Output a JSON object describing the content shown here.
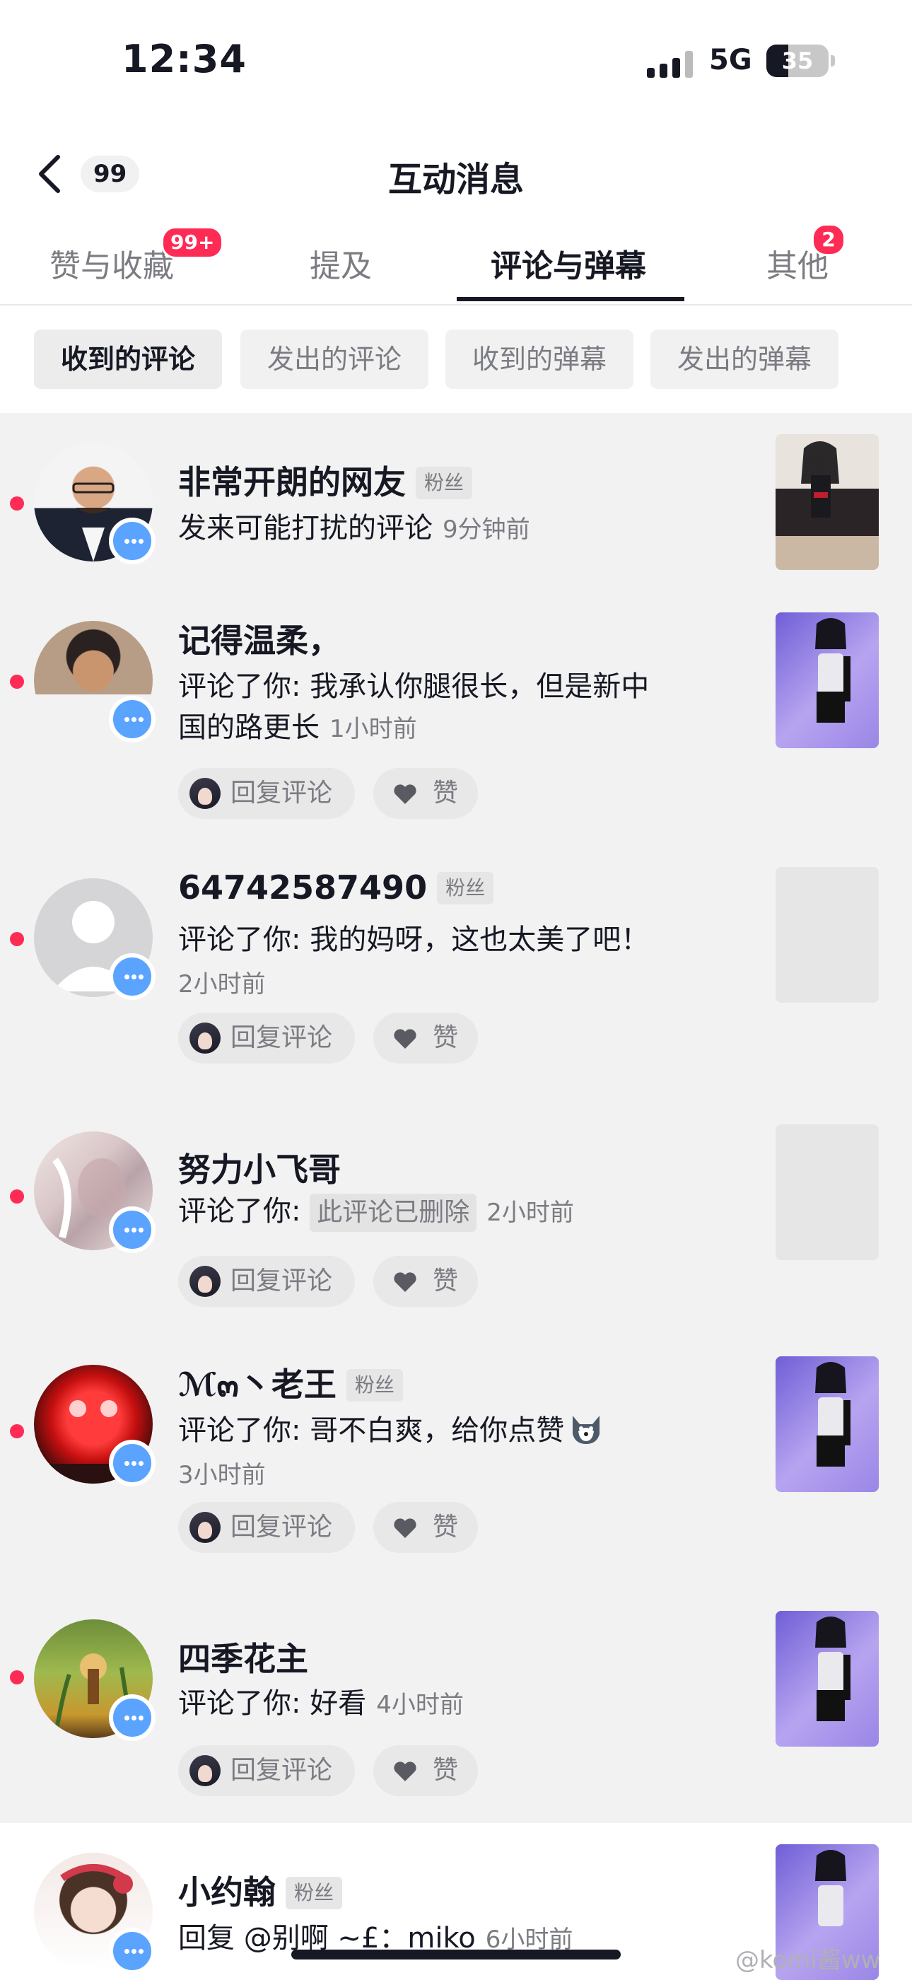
{
  "status_bar": {
    "time": "12:34",
    "network": "5G",
    "battery": 35
  },
  "header": {
    "back_count": "99",
    "title": "互动消息"
  },
  "tabs": [
    {
      "label": "赞与收藏",
      "badge": "99+"
    },
    {
      "label": "提及",
      "badge": ""
    },
    {
      "label": "评论与弹幕",
      "badge": "",
      "active": true
    },
    {
      "label": "其他",
      "badge": "2"
    }
  ],
  "filters": [
    "收到的评论",
    "发出的评论",
    "收到的弹幕",
    "发出的弹幕"
  ],
  "actions": {
    "reply": "回复评论",
    "like": "赞"
  },
  "items": [
    {
      "name": "非常开朗的网友",
      "tag": "粉丝",
      "text": "发来可能打扰的评论",
      "time": "9分钟前"
    },
    {
      "name": "记得温柔，",
      "tag": "",
      "text": "评论了你: 我承认你腿很长，但是新中国的路更长",
      "time": "1小时前"
    },
    {
      "name": "64742587490",
      "tag": "粉丝",
      "text": "评论了你: 我的妈呀，这也太美了吧！",
      "time": "2小时前"
    },
    {
      "name": "努力小飞哥",
      "tag": "",
      "text_prefix": "评论了你: ",
      "deleted": "此评论已删除",
      "time": "2小时前"
    },
    {
      "name": "ℳ๓丶老王",
      "tag": "粉丝",
      "text": "评论了你: 哥不白爽，给你点赞",
      "time": "3小时前"
    },
    {
      "name": "四季花主",
      "tag": "",
      "text": "评论了你: 好看",
      "time": "4小时前"
    },
    {
      "name": "小约翰",
      "tag": "粉丝",
      "text": "回复 @别啊 ~£：miko",
      "time": "6小时前"
    }
  ],
  "watermark": "@komi酱ww",
  "colors": {
    "accent": "#fe2c55",
    "comment_badge": "#5aa3ff"
  }
}
